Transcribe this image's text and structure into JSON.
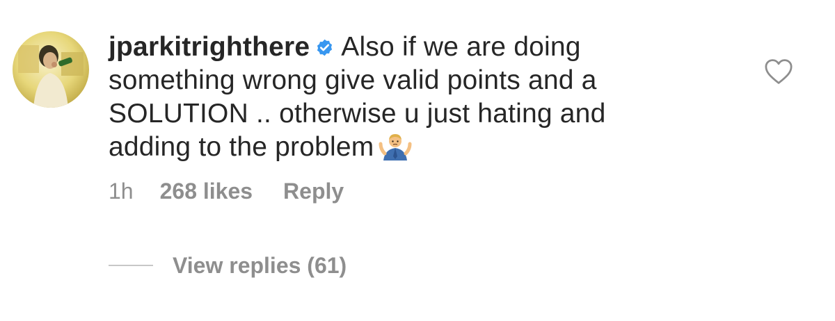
{
  "comment": {
    "username": "jparkitrighthere",
    "verified": true,
    "text_line1": "Also if we are doing",
    "text_rest": "something wrong give valid points and a SOLUTION .. otherwise u just hating and adding to the problem",
    "emoji": "person-shrugging-icon",
    "time": "1h",
    "likes": "268 likes",
    "reply_label": "Reply",
    "view_replies": "View replies (61)"
  },
  "colors": {
    "text": "#262626",
    "secondary": "#8e8e8e",
    "verified_blue": "#3897f0",
    "divider": "#c7c7c7"
  },
  "icons": {
    "like": "heart-outline-icon",
    "verified": "verified-badge-icon"
  }
}
